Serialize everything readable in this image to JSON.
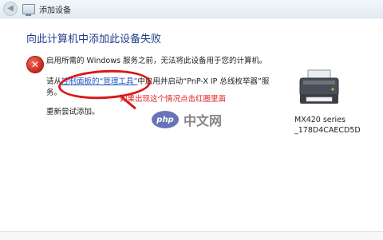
{
  "window": {
    "title": "添加设备",
    "heading": "向此计算机中添加此设备失败"
  },
  "error": {
    "line1": "启用所需的 Windows 服务之前，无法将此设备用于您的计算机。",
    "line2_prefix": "请从",
    "link_text": "控制面板的“管理工具”",
    "line2_suffix": "中启用并启动“PnP-X IP 总线枚举器”服务。",
    "line3": "重新尝试添加。"
  },
  "annotation": {
    "text": "如果出现这个情况点击红圈里面",
    "color": "#d81818"
  },
  "device": {
    "name": "MX420 series",
    "id": "_178D4CAECD5D",
    "icon": "printer-icon"
  },
  "watermark": {
    "badge": "php",
    "text": "中文网"
  }
}
